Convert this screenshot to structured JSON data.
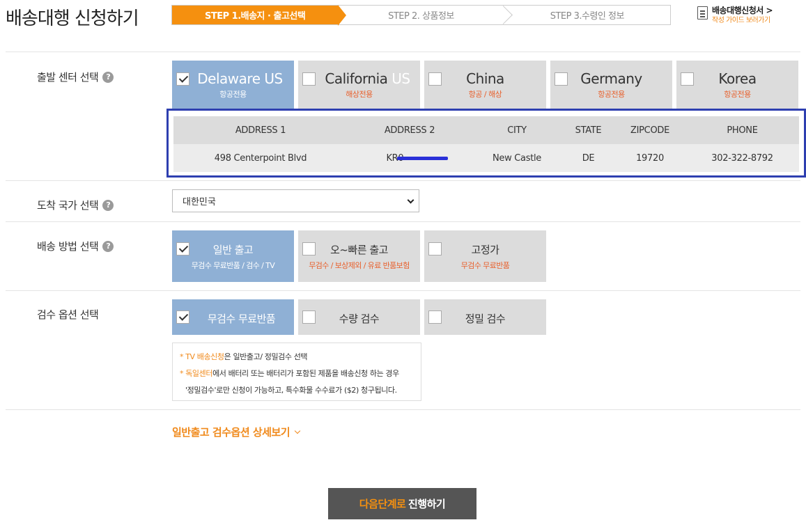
{
  "header": {
    "title": "배송대행 신청하기",
    "steps": [
      "STEP 1.배송지 · 출고선택",
      "STEP 2. 상품정보",
      "STEP 3.수령인 정보"
    ],
    "guide_title": "배송대행신청서 >",
    "guide_sub": "작성 가이드 보러가기"
  },
  "departure": {
    "label": "출발 센터 선택",
    "help": "?",
    "centers": [
      {
        "name": "Delaware US",
        "sub": "항공전용",
        "selected": true
      },
      {
        "name_pre": "California ",
        "name_hl": "US",
        "sub": "해상전용",
        "selected": false
      },
      {
        "name": "China",
        "sub": "항공 / 해상",
        "selected": false
      },
      {
        "name": "Germany",
        "sub": "항공전용",
        "selected": false
      },
      {
        "name": "Korea",
        "sub": "항공전용",
        "selected": false
      }
    ]
  },
  "address": {
    "headers": [
      "ADDRESS 1",
      "ADDRESS 2",
      "CITY",
      "STATE",
      "ZIPCODE",
      "PHONE"
    ],
    "row": [
      "498 Centerpoint Blvd",
      "KR0",
      "New Castle",
      "DE",
      "19720",
      "302-322-8792"
    ]
  },
  "arrival": {
    "label": "도착 국가 선택",
    "help": "?",
    "selected": "대한민국"
  },
  "shipping": {
    "label": "배송 방법 선택",
    "help": "?",
    "methods": [
      {
        "title": "일반 출고",
        "sub": "무검수 무료반품 / 검수 / TV",
        "selected": true
      },
      {
        "title": "오~빠른 출고",
        "sub": "무검수 / 보상제외 / 유료 반품보험",
        "selected": false
      },
      {
        "title": "고정가",
        "sub": "무검수 무료반품",
        "selected": false
      }
    ]
  },
  "inspection": {
    "label": "검수 옵션 선택",
    "options": [
      {
        "title": "무검수 무료반품",
        "selected": true
      },
      {
        "title": "수량 검수",
        "selected": false
      },
      {
        "title": "정밀 검수",
        "selected": false
      }
    ],
    "notes": {
      "l1_star": "* TV 배송신청",
      "l1_rest": "은 일반출고/ 정밀검수 선택",
      "l2_star": "* 독일센터",
      "l2_rest": "에서 배터리 또는 배터리가 포함된 제품을 배송신청 하는 경우",
      "l3": "'정밀검수'로만 신청이 가능하고, 특수화물 수수료가 ($2) 청구됩니다."
    },
    "detail_link": "일반출고 검수옵션 상세보기"
  },
  "next_button": {
    "orange": "다음단계로",
    "white": " 진행하기"
  },
  "colors": {
    "accent": "#f5900f",
    "selected": "#8fb0d5",
    "option_bg": "#dcdcdc",
    "highlight_border": "#2e3fb0"
  }
}
